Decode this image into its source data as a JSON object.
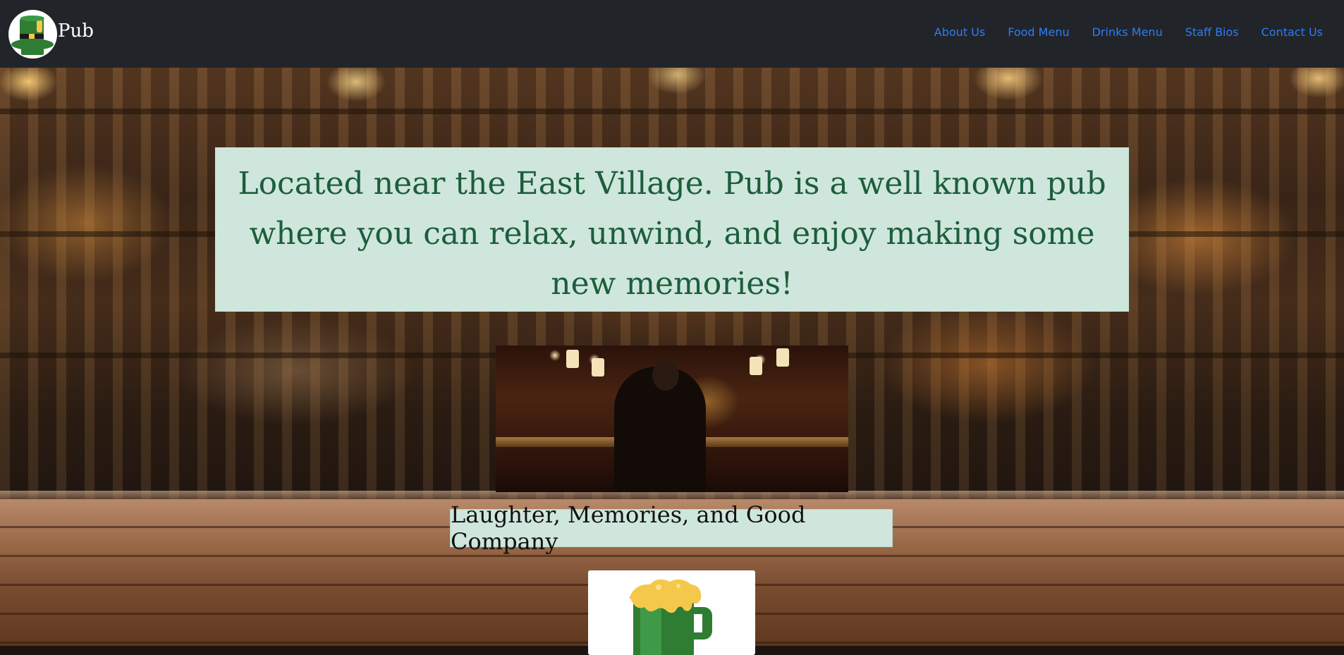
{
  "brand": {
    "name": "Pub",
    "logo_text": "PUB"
  },
  "nav": {
    "items": [
      {
        "label": "About Us"
      },
      {
        "label": "Food Menu"
      },
      {
        "label": "Drinks Menu"
      },
      {
        "label": "Staff Bios"
      },
      {
        "label": "Contact Us"
      }
    ]
  },
  "hero": {
    "intro": "Located near the East Village. Pub is a well known pub where you can relax, unwind, and enjoy making some new memories!",
    "tagline": "Laughter, Memories, and Good Company"
  },
  "images": {
    "hero_background": "blurred-bar-shelves-with-wooden-counter",
    "bar_photo": "man-in-suit-at-bar-counter",
    "logo_card": "green-beer-mug-icon"
  },
  "colors": {
    "navbar_bg": "#212529",
    "nav_link": "#2f7bf5",
    "panel_bg": "#cfe6dc",
    "intro_text": "#1b5e3b",
    "beer_green": "#2e7d32",
    "beer_foam": "#f4c84a"
  }
}
